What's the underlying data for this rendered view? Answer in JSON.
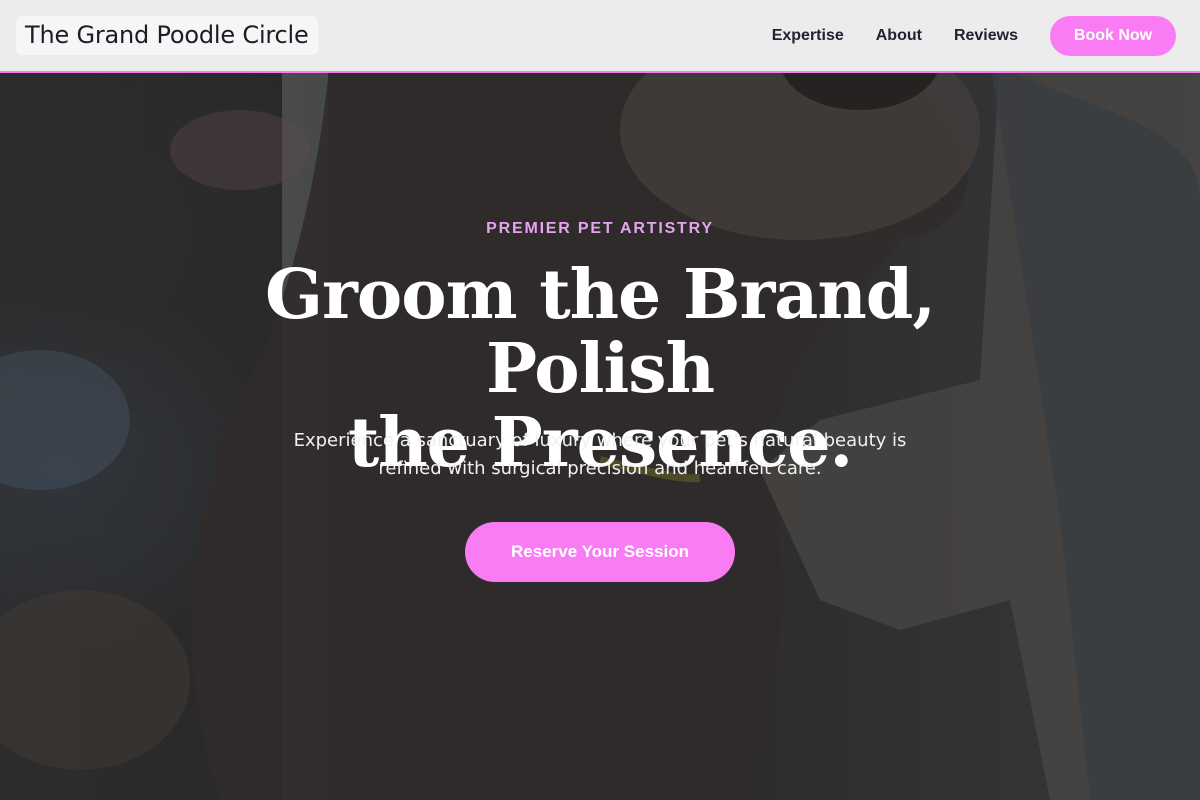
{
  "nav": {
    "brand": "The Grand Poodle Circle",
    "links": [
      {
        "label": "Expertise"
      },
      {
        "label": "About"
      },
      {
        "label": "Reviews"
      }
    ],
    "cta_label": "Book Now"
  },
  "hero": {
    "eyebrow": "PREMIER PET ARTISTRY",
    "headline_line1": "Groom the Brand, Polish",
    "headline_line2": "the Presence.",
    "subtext": "Experience a sanctuary of luxury where your pet's natural beauty is refined with surgical precision and heartfelt care.",
    "cta_label": "Reserve Your Session"
  },
  "colors": {
    "accent": "#fa7cf5",
    "eyebrow": "#e6a3ee",
    "nav_bg": "#ececec",
    "nav_border": "#f47ff0"
  }
}
